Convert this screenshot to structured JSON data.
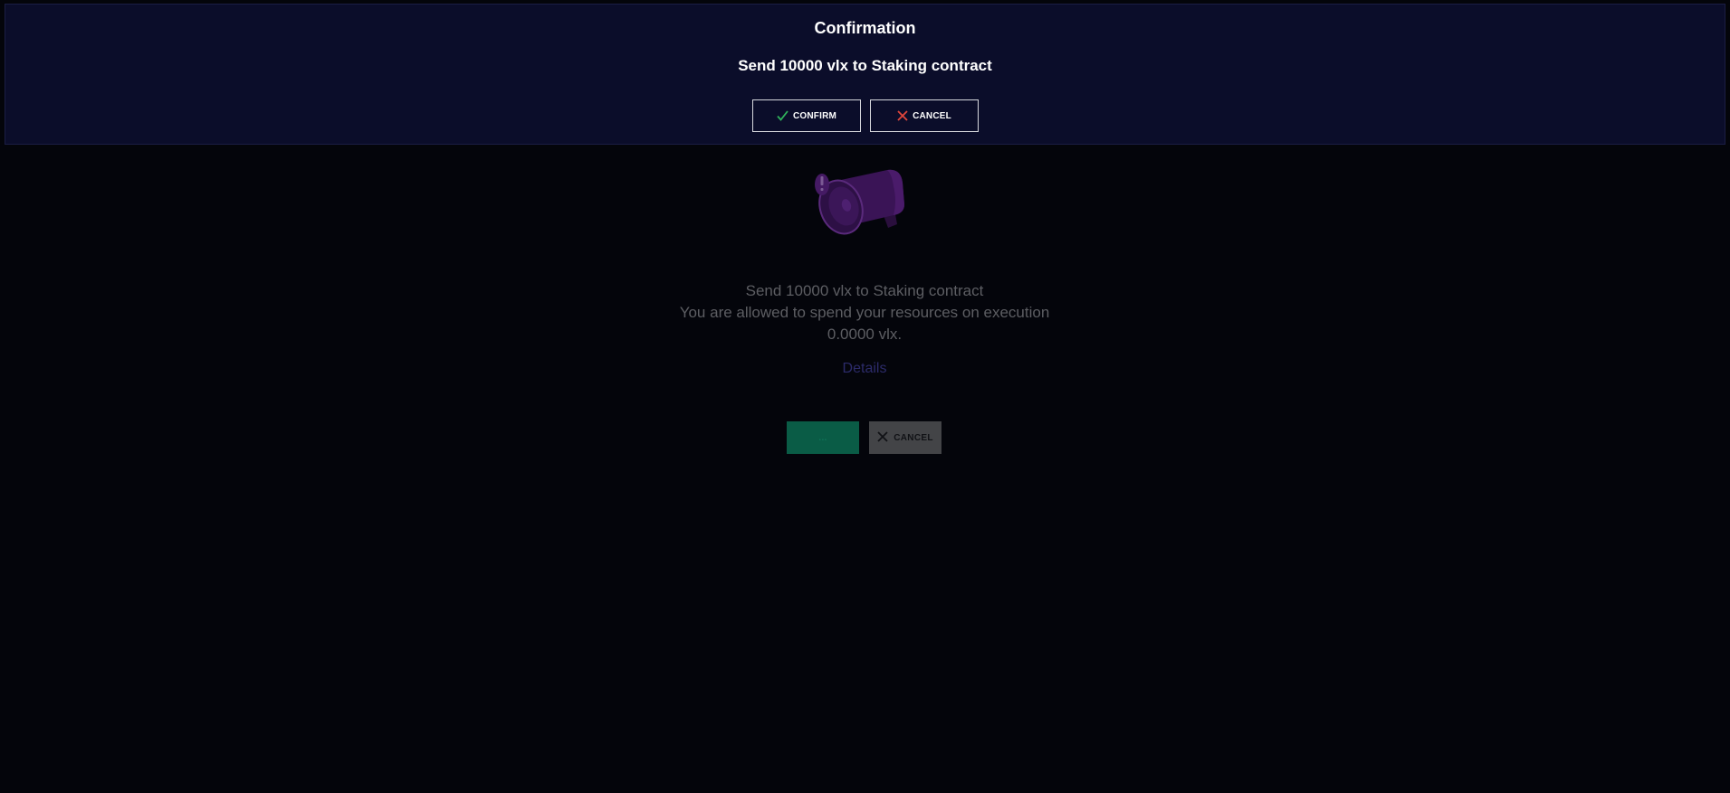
{
  "modal": {
    "title": "Confirmation",
    "message": "Send 10000 vlx to Staking contract",
    "confirm_label": "CONFIRM",
    "cancel_label": "CANCEL"
  },
  "background": {
    "message_line1": "Send 10000 vlx to Staking contract",
    "message_line2": "You are allowed to spend your resources on execution",
    "message_line3": "0.0000 vlx.",
    "details_link": "Details",
    "confirm_button_label": "...",
    "cancel_button_label": "CANCEL",
    "illustration": "megaphone-icon"
  },
  "colors": {
    "page_background": "#04050b",
    "modal_background": "#0b0d2a",
    "confirm_check": "#2fb25b",
    "cancel_x": "#e0463c",
    "confirm_bg_button": "#0a5c46",
    "cancel_bg_button": "#434447",
    "details_link": "#2c2b6a"
  }
}
